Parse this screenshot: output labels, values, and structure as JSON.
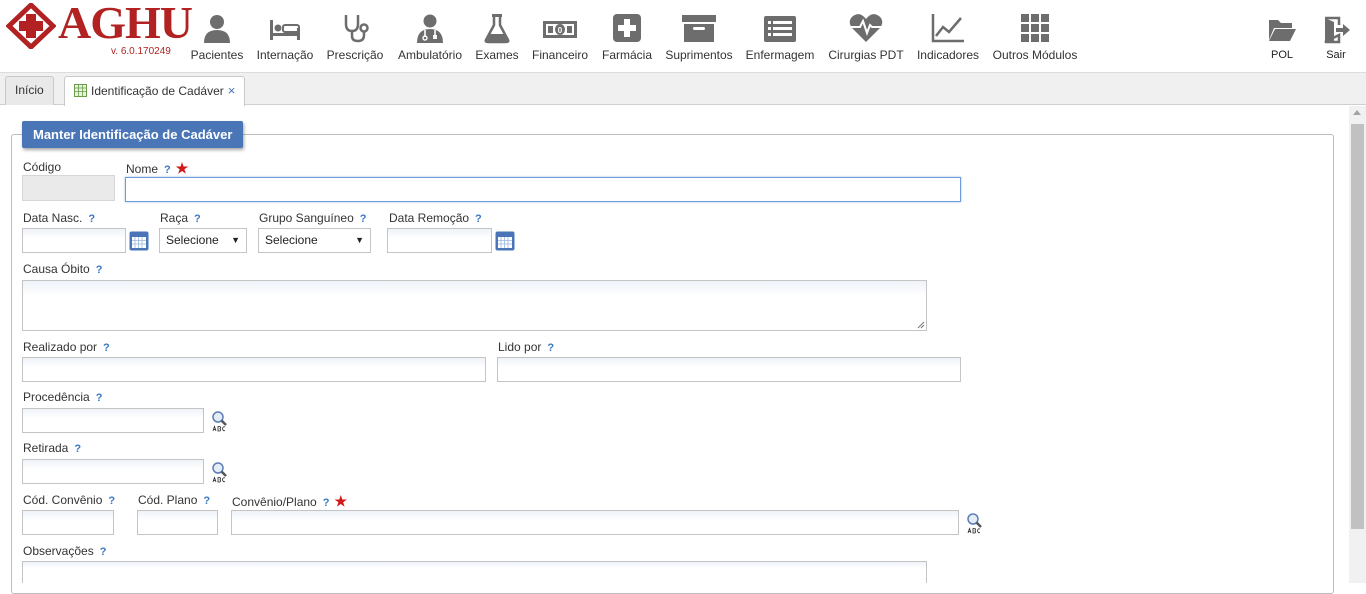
{
  "app": {
    "name": "AGHU",
    "version": "v. 6.0.170249"
  },
  "menu": [
    {
      "label": "Pacientes",
      "icon": "user-icon"
    },
    {
      "label": "Internação",
      "icon": "bed-icon"
    },
    {
      "label": "Prescrição",
      "icon": "stethoscope-icon"
    },
    {
      "label": "Ambulatório",
      "icon": "doctor-icon"
    },
    {
      "label": "Exames",
      "icon": "flask-icon"
    },
    {
      "label": "Financeiro",
      "icon": "money-icon"
    },
    {
      "label": "Farmácia",
      "icon": "plus-box-icon"
    },
    {
      "label": "Suprimentos",
      "icon": "archive-icon"
    },
    {
      "label": "Enfermagem",
      "icon": "list-icon"
    },
    {
      "label": "Cirurgias PDT",
      "icon": "heartbeat-icon"
    },
    {
      "label": "Indicadores",
      "icon": "line-chart-icon"
    },
    {
      "label": "Outros Módulos",
      "icon": "grid-icon"
    }
  ],
  "right_menu": [
    {
      "label": "POL",
      "icon": "folder-open-icon"
    },
    {
      "label": "Sair",
      "icon": "sign-out-icon"
    }
  ],
  "tabs": [
    {
      "label": "Início"
    },
    {
      "label": "Identificação de Cadáver",
      "close": "×"
    }
  ],
  "form": {
    "title": "Manter Identificação de Cadáver",
    "help_symbol": "?",
    "required_symbol": "★",
    "codigo": {
      "label": "Código",
      "value": ""
    },
    "nome": {
      "label": "Nome",
      "value": ""
    },
    "data_nasc": {
      "label": "Data Nasc.",
      "value": ""
    },
    "raca": {
      "label": "Raça",
      "selected": "Selecione"
    },
    "grupo_sanguineo": {
      "label": "Grupo Sanguíneo",
      "selected": "Selecione"
    },
    "data_remocao": {
      "label": "Data Remoção",
      "value": ""
    },
    "causa_obito": {
      "label": "Causa Óbito",
      "value": ""
    },
    "realizado_por": {
      "label": "Realizado por",
      "value": ""
    },
    "lido_por": {
      "label": "Lido por",
      "value": ""
    },
    "procedencia": {
      "label": "Procedência",
      "value": ""
    },
    "retirada": {
      "label": "Retirada",
      "value": ""
    },
    "cod_convenio": {
      "label": "Cód. Convênio",
      "value": ""
    },
    "cod_plano": {
      "label": "Cód. Plano",
      "value": ""
    },
    "convenio_plano": {
      "label": "Convênio/Plano",
      "value": ""
    },
    "observacoes": {
      "label": "Observações",
      "value": ""
    }
  },
  "colors": {
    "brand": "#b22222",
    "accent": "#4a76b8",
    "help": "#3a78c3",
    "required": "#d01a1a",
    "icon": "#6d6d6d"
  }
}
